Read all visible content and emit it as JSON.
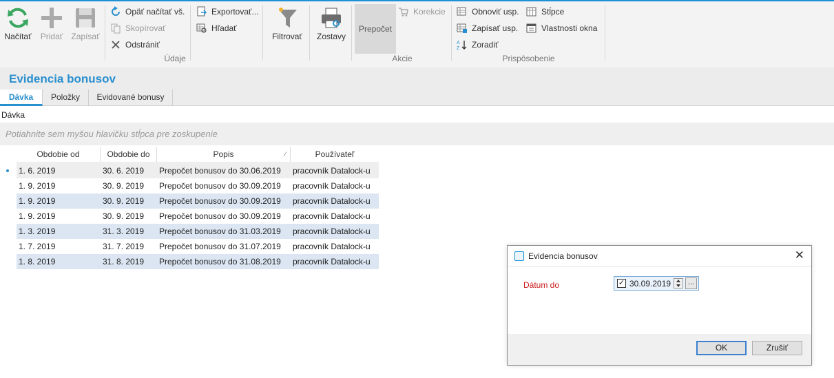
{
  "ribbon": {
    "data_group": {
      "refresh_label": "Načítať",
      "add_label": "Pridať",
      "save_label": "Zapísať",
      "reload_all_label": "Opäť načítať vš.",
      "copy_label": "Skopírovať",
      "delete_label": "Odstrániť",
      "export_label": "Exportovať...",
      "find_label": "Hľadať",
      "filter_label": "Filtrovať",
      "reports_label": "Zostavy",
      "group_label": "Údaje"
    },
    "actions_group": {
      "recalc_label": "Prepočet",
      "corrections_label": "Korekcie",
      "group_label": "Akcie"
    },
    "custom_group": {
      "refresh_setup_label": "Obnoviť usp.",
      "save_setup_label": "Zapísať usp.",
      "sort_label": "Zoradiť",
      "columns_label": "Stĺpce",
      "window_props_label": "Vlastnosti okna",
      "group_label": "Prispôsobenie"
    }
  },
  "page": {
    "title": "Evidencia bonusov",
    "tabs": [
      {
        "label": "Dávka"
      },
      {
        "label": "Položky"
      },
      {
        "label": "Evidované bonusy"
      }
    ],
    "section_label": "Dávka",
    "group_hint": "Potiahnite sem myšou hlavičku stĺpca pre zoskupenie"
  },
  "grid": {
    "columns": [
      "Obdobie od",
      "Obdobie do",
      "Popis",
      "Používateľ"
    ],
    "sort_marker": "⁄",
    "rows": [
      {
        "from": "1. 6. 2019",
        "to": "30. 6. 2019",
        "desc": "Prepočet bonusov do 30.06.2019",
        "user": "pracovník Datalock-u"
      },
      {
        "from": "1. 9. 2019",
        "to": "30. 9. 2019",
        "desc": "Prepočet bonusov do 30.09.2019",
        "user": "pracovník Datalock-u"
      },
      {
        "from": "1. 9. 2019",
        "to": "30. 9. 2019",
        "desc": "Prepočet bonusov do 30.09.2019",
        "user": "pracovník Datalock-u"
      },
      {
        "from": "1. 9. 2019",
        "to": "30. 9. 2019",
        "desc": "Prepočet bonusov do 30.09.2019",
        "user": "pracovník Datalock-u"
      },
      {
        "from": "1. 3. 2019",
        "to": "31. 3. 2019",
        "desc": "Prepočet bonusov do 31.03.2019",
        "user": "pracovník Datalock-u"
      },
      {
        "from": "1. 7. 2019",
        "to": "31. 7. 2019",
        "desc": "Prepočet bonusov do 31.07.2019",
        "user": "pracovník Datalock-u"
      },
      {
        "from": "1. 8. 2019",
        "to": "31. 8. 2019",
        "desc": "Prepočet bonusov do 31.08.2019",
        "user": "pracovník Datalock-u"
      }
    ]
  },
  "dialog": {
    "title": "Evidencia bonusov",
    "close_glyph": "✕",
    "date_label": "Dátum do",
    "date_value": "30.09.2019",
    "checked_glyph": "✓",
    "more_glyph": "...",
    "ok_label": "OK",
    "cancel_label": "Zrušiť"
  },
  "colors": {
    "accent": "#2a8fcf",
    "alt_row": "#dbe6f2",
    "required_label": "#cc1b1b"
  }
}
